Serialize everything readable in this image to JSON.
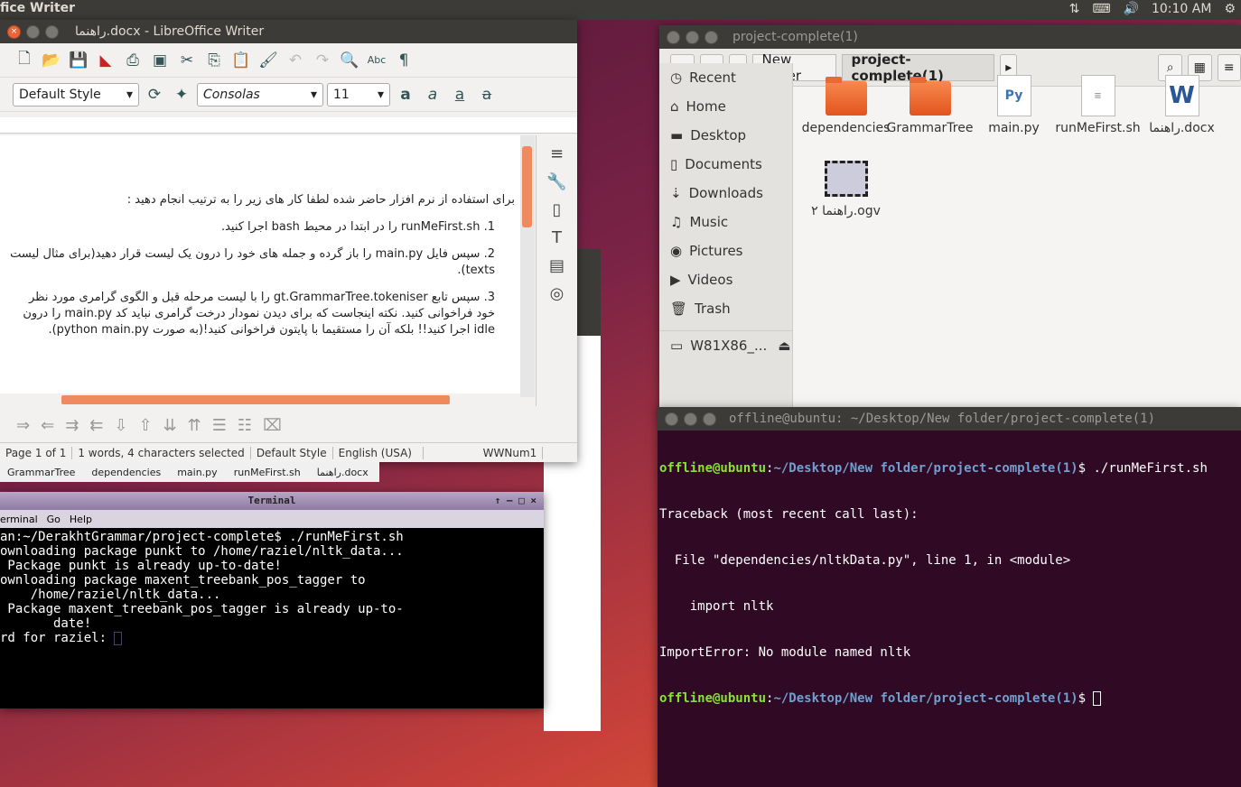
{
  "topbar": {
    "app": "fice Writer",
    "time": "10:10 AM"
  },
  "writer": {
    "title": "راهنما.docx - LibreOffice Writer",
    "style": "Default Style",
    "font": "Consolas",
    "size": "11",
    "lines": [
      "برای استفاده از نرم افزار حاضر شده لطفا کار های زیر را به ترتیب انجام دهید :",
      "1. runMeFirst.sh را در ابتدا در محیط bash اجرا کنید.",
      "2. سپس فایل main.py را باز گرده و جمله های خود را درون یک لیست قرار دهید(برای مثال لیست texts).",
      "3. سپس تابع gt.GrammarTree.tokeniser را با لیست مرحله قبل و الگوی گرامری مورد نظر خود فراخوانی کنید. نکته اینجاست که برای دیدن نمودار درخت گرامری نباید کد main.py را درون idle اجرا کنید!! بلکه آن را مستقیما با پایتون فراخوانی کنید!(به صورت python main.py)."
    ],
    "status": {
      "page": "Page 1 of 1",
      "words": "1 words, 4 characters selected",
      "style": "Default Style",
      "lang": "English (USA)",
      "num": "WWNum1"
    }
  },
  "strip": [
    "GrammarTree",
    "dependencies",
    "main.py",
    "runMeFirst.sh",
    "راهنما.docx"
  ],
  "files": {
    "title": "project-complete(1)",
    "crumbs": [
      "New folder",
      "project-complete(1)"
    ],
    "places": [
      "Recent",
      "Home",
      "Desktop",
      "Documents",
      "Downloads",
      "Music",
      "Pictures",
      "Videos",
      "Trash",
      "W81X86_..."
    ],
    "items": [
      "dependencies",
      "GrammarTree",
      "main.py",
      "runMeFirst.sh",
      "راهنما.docx",
      "راهنما ۲.ogv"
    ]
  },
  "term2": {
    "title": "offline@ubuntu: ~/Desktop/New folder/project-complete(1)",
    "user": "offline@ubuntu",
    "path": "~/Desktop/New folder/project-complete(1)",
    "cmd": "$ ./runMeFirst.sh",
    "l1": "Traceback (most recent call last):",
    "l2": "  File \"dependencies/nltkData.py\", line 1, in <module>",
    "l3": "    import nltk",
    "l4": "ImportError: No module named nltk",
    "prompt2": "$ "
  },
  "term1": {
    "title": "Terminal",
    "menu": [
      "erminal",
      "Go",
      "Help"
    ],
    "l1": "an:~/DerakhtGrammar/project-complete$ ./runMeFirst.sh",
    "l2": "ownloading package punkt to /home/raziel/nltk_data...",
    "l3": " Package punkt is already up-to-date!",
    "l4": "ownloading package maxent_treebank_pos_tagger to",
    "l5": "    /home/raziel/nltk_data...",
    "l6": " Package maxent_treebank_pos_tagger is already up-to-",
    "l7": "       date!",
    "l8": "rd for raziel: "
  }
}
